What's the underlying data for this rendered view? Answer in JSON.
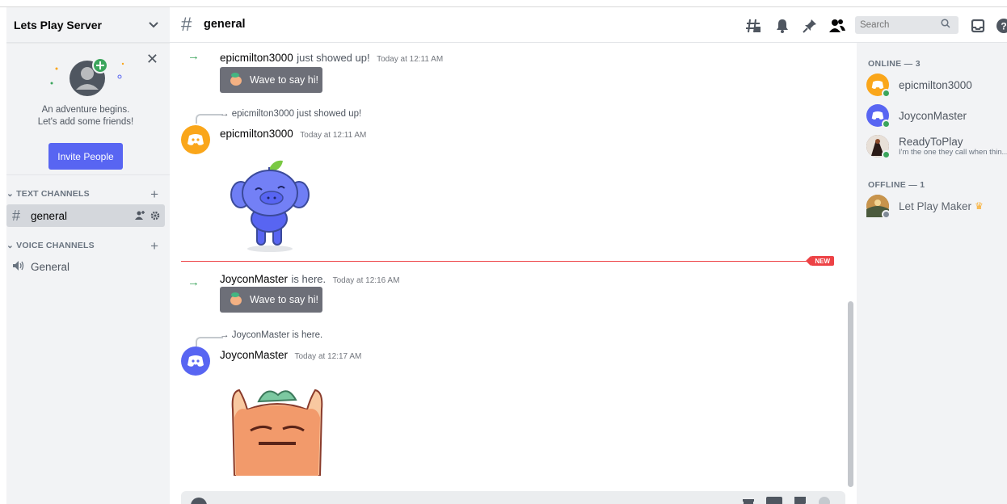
{
  "server": {
    "name": "Lets Play Server"
  },
  "invite": {
    "line1": "An adventure begins.",
    "line2": "Let's add some friends!",
    "button": "Invite People"
  },
  "sidebar": {
    "text_category": "TEXT CHANNELS",
    "voice_category": "VOICE CHANNELS",
    "text_channels": [
      {
        "name": "general"
      }
    ],
    "voice_channels": [
      {
        "name": "General"
      }
    ]
  },
  "header": {
    "channel": "general",
    "search_placeholder": "Search",
    "icons": [
      "threads-icon",
      "bell-icon",
      "pin-icon",
      "members-icon",
      "search-icon",
      "inbox-icon",
      "help-icon"
    ]
  },
  "messages": [
    {
      "type": "join",
      "user": "epicmilton3000",
      "text": "just showed up!",
      "time": "Today at 12:11 AM",
      "button": "Wave to say hi!"
    },
    {
      "type": "reply",
      "reply_user": "epicmilton3000",
      "reply_text": "just showed up!",
      "user": "epicmilton3000",
      "time": "Today at 12:11 AM",
      "avatar_color": "#faa61a"
    },
    {
      "type": "join",
      "user": "JoyconMaster",
      "text": "is here.",
      "time": "Today at 12:16 AM",
      "button": "Wave to say hi!"
    },
    {
      "type": "reply",
      "reply_user": "JoyconMaster",
      "reply_text": "is here.",
      "user": "JoyconMaster",
      "time": "Today at 12:17 AM",
      "avatar_color": "#5865f2"
    }
  ],
  "new_badge": "NEW",
  "members": {
    "online_label": "ONLINE — 3",
    "offline_label": "OFFLINE — 1",
    "online": [
      {
        "name": "epicmilton3000",
        "avatar_color": "#faa61a",
        "status": "online"
      },
      {
        "name": "JoyconMaster",
        "avatar_color": "#5865f2",
        "status": "online"
      },
      {
        "name": "ReadyToPlay",
        "subtitle": "I'm the one they call when thin...",
        "avatar_color": "#6b4a3a",
        "status": "online"
      }
    ],
    "offline": [
      {
        "name": "Let Play Maker",
        "avatar_color": "#8a6a3a",
        "status": "offline",
        "crown": true
      }
    ]
  },
  "colors": {
    "accent": "#5865f2",
    "online": "#3ba55c",
    "new": "#ed4245"
  }
}
